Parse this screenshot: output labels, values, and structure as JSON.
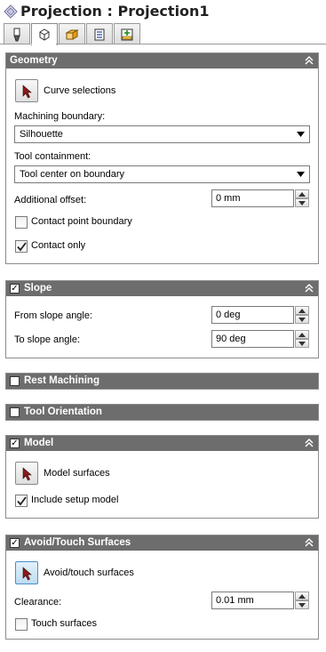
{
  "title": "Projection : Projection1",
  "tabs": [
    {
      "icon": "tool-icon",
      "active": false
    },
    {
      "icon": "geometry-cube-icon",
      "active": true
    },
    {
      "icon": "heights-icon",
      "active": false
    },
    {
      "icon": "passes-icon",
      "active": false
    },
    {
      "icon": "linking-icon",
      "active": false
    }
  ],
  "geometry": {
    "header": "Geometry",
    "curve_selections_label": "Curve selections",
    "machining_boundary_label": "Machining boundary:",
    "machining_boundary_value": "Silhouette",
    "tool_containment_label": "Tool containment:",
    "tool_containment_value": "Tool center on boundary",
    "additional_offset_label": "Additional offset:",
    "additional_offset_value": "0 mm",
    "contact_point_boundary_label": "Contact point boundary",
    "contact_point_boundary_checked": false,
    "contact_only_label": "Contact only",
    "contact_only_checked": true
  },
  "slope": {
    "header": "Slope",
    "enabled": true,
    "from_label": "From slope angle:",
    "from_value": "0 deg",
    "to_label": "To slope angle:",
    "to_value": "90 deg"
  },
  "rest_machining": {
    "header": "Rest Machining",
    "enabled": false
  },
  "tool_orientation": {
    "header": "Tool Orientation",
    "enabled": false
  },
  "model": {
    "header": "Model",
    "enabled": true,
    "model_surfaces_label": "Model surfaces",
    "include_setup_label": "Include setup model",
    "include_setup_checked": true
  },
  "avoid": {
    "header": "Avoid/Touch Surfaces",
    "enabled": true,
    "avoid_touch_label": "Avoid/touch surfaces",
    "clearance_label": "Clearance:",
    "clearance_value": "0.01 mm",
    "touch_surfaces_label": "Touch surfaces",
    "touch_surfaces_checked": false
  },
  "colors": {
    "section_header": "#6d6d6d",
    "border": "#8c8c8c",
    "pick_arrow": "#8b1a1a"
  }
}
